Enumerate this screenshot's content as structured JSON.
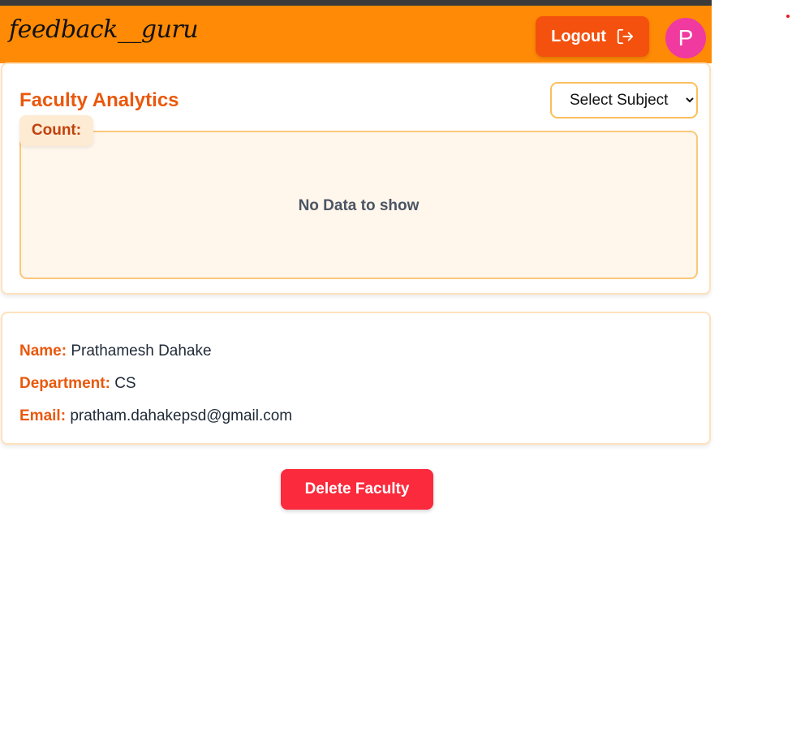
{
  "header": {
    "brand": "feedback__guru",
    "logout_label": "Logout",
    "avatar_initial": "P"
  },
  "analytics": {
    "title": "Faculty Analytics",
    "subject_select": {
      "selected": "Select Subject"
    },
    "count_label": "Count:",
    "empty_message": "No Data to show"
  },
  "faculty": {
    "name_label": "Name:",
    "name_value": "Prathamesh Dahake",
    "department_label": "Department:",
    "department_value": "CS",
    "email_label": "Email:",
    "email_value": "pratham.dahakepsd@gmail.com"
  },
  "actions": {
    "delete_label": "Delete Faculty"
  },
  "colors": {
    "navbar": "#ff8a05",
    "accent": "#ea580c",
    "logout": "#f4510e",
    "avatar": "#f03aa0",
    "delete": "#fb2a3c"
  },
  "icons": {
    "logout": "logout-icon",
    "dropdown": "chevron-down-icon"
  }
}
